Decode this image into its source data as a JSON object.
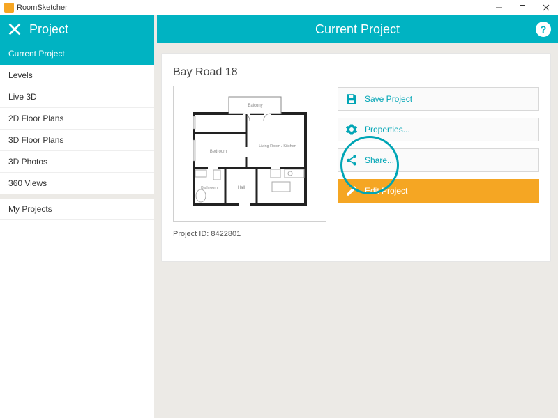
{
  "app": {
    "title": "RoomSketcher"
  },
  "sidebar": {
    "header": "Project",
    "items": [
      {
        "label": "Current Project",
        "active": true
      },
      {
        "label": "Levels",
        "active": false
      },
      {
        "label": "Live 3D",
        "active": false
      },
      {
        "label": "2D Floor Plans",
        "active": false
      },
      {
        "label": "3D Floor Plans",
        "active": false
      },
      {
        "label": "3D Photos",
        "active": false
      },
      {
        "label": "360 Views",
        "active": false
      }
    ],
    "secondary": [
      {
        "label": "My Projects"
      }
    ]
  },
  "main": {
    "header_title": "Current Project",
    "help_glyph": "?",
    "project_title": "Bay Road 18",
    "project_id_label": "Project ID: 8422801",
    "floorplan": {
      "rooms": {
        "balcony": "Balcony",
        "bedroom": "Bedroom",
        "living": "Living Room / Kitchen",
        "bathroom": "Bathroom",
        "hall": "Hall"
      }
    },
    "actions": {
      "save": "Save Project",
      "properties": "Properties...",
      "share": "Share...",
      "edit": "Edit Project"
    }
  },
  "colors": {
    "accent": "#00b3c2",
    "accent_dark": "#00a5b5",
    "edit_bg": "#f5a623"
  }
}
